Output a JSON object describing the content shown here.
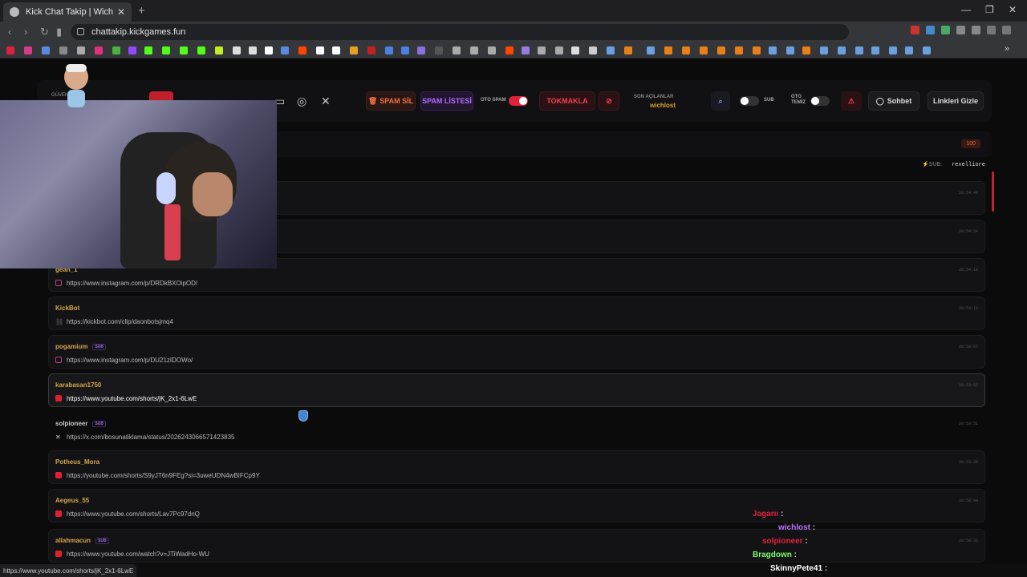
{
  "browser": {
    "tab_title": "Kick Chat Takip | Wich",
    "new_tab": "+",
    "close_tab": "✕",
    "url": "chattakip.kickgames.fun",
    "status_url": "https://www.youtube.com/shorts/jK_2x1-6LwE",
    "minimize": "—",
    "maximize": "❐",
    "close": "✕"
  },
  "topbar": {
    "guven_label": "GÜVEN",
    "spam_sil": "SPAM SİL",
    "spam_listesi": "SPAM LİSTESİ",
    "oto_spam": "OTO SPAM",
    "tokmakla": "TOKMAKLA",
    "son_acilanlar_label": "SON AÇILANLAR",
    "son_acilanlar_value": "wichlost",
    "sub_label": "SUB",
    "oto_temiz_label": "OTO TEMİZ",
    "sohbet": "Sohbet",
    "linkleri_gizle": "Linkleri Gizle"
  },
  "header": {
    "count_badge": "100",
    "sub_label": "SUB:",
    "sub_value": "rexelliore"
  },
  "messages": [
    {
      "user": "gean_1",
      "sub": false,
      "link": "https://www.instagram.com/p/DRDkBXOipOD/",
      "icon": "instagram",
      "time": "20:54:19"
    },
    {
      "user": "KickBot",
      "sub": false,
      "link": "https://kickbot.com/clip/daonbotsjmq4",
      "icon": "link",
      "time": "20:54:16"
    },
    {
      "user": "pogamium",
      "sub": true,
      "link": "https://www.instagram.com/p/DU21zIDOWo/",
      "icon": "instagram",
      "time": "20:50:07"
    },
    {
      "user": "karabasan1750",
      "sub": false,
      "link": "https://www.youtube.com/shorts/jK_2x1-6LwE",
      "icon": "youtube",
      "time": "20:53:52"
    },
    {
      "user": "solpioneer",
      "sub": true,
      "link": "https://x.com/bosunatiklama/status/2026243066571423835",
      "icon": "x",
      "time": "20:53:51"
    },
    {
      "user": "Potheus_Mora",
      "sub": false,
      "link": "https://youtube.com/shorts/S9yJT6n9FEg?si=3uweUDN4wBIFCp9Y",
      "icon": "youtube",
      "time": "20:53:39"
    },
    {
      "user": "Aegeus_55",
      "sub": false,
      "link": "https://www.youtube.com/shorts/Lav7Pc97dnQ",
      "icon": "youtube",
      "time": "20:50:44"
    },
    {
      "user": "allahmacun",
      "sub": true,
      "link": "https://www.youtube.com/watch?v=JTiWadHo-WU",
      "icon": "youtube",
      "time": "20:50:35"
    }
  ],
  "sub_tag": "SUB",
  "top_times": [
    "20:54:49",
    "20:54:34"
  ],
  "overlay_chat": [
    {
      "name": "Jagarıı",
      "color": "#e0233b"
    },
    {
      "name": "wichlost",
      "color": "#c070ff"
    },
    {
      "name": "solpioneer",
      "color": "#e0233b"
    },
    {
      "name": "Bragdown",
      "color": "#7cfc6a"
    },
    {
      "name": "SkinnyPete41",
      "color": "#ffffff"
    }
  ]
}
